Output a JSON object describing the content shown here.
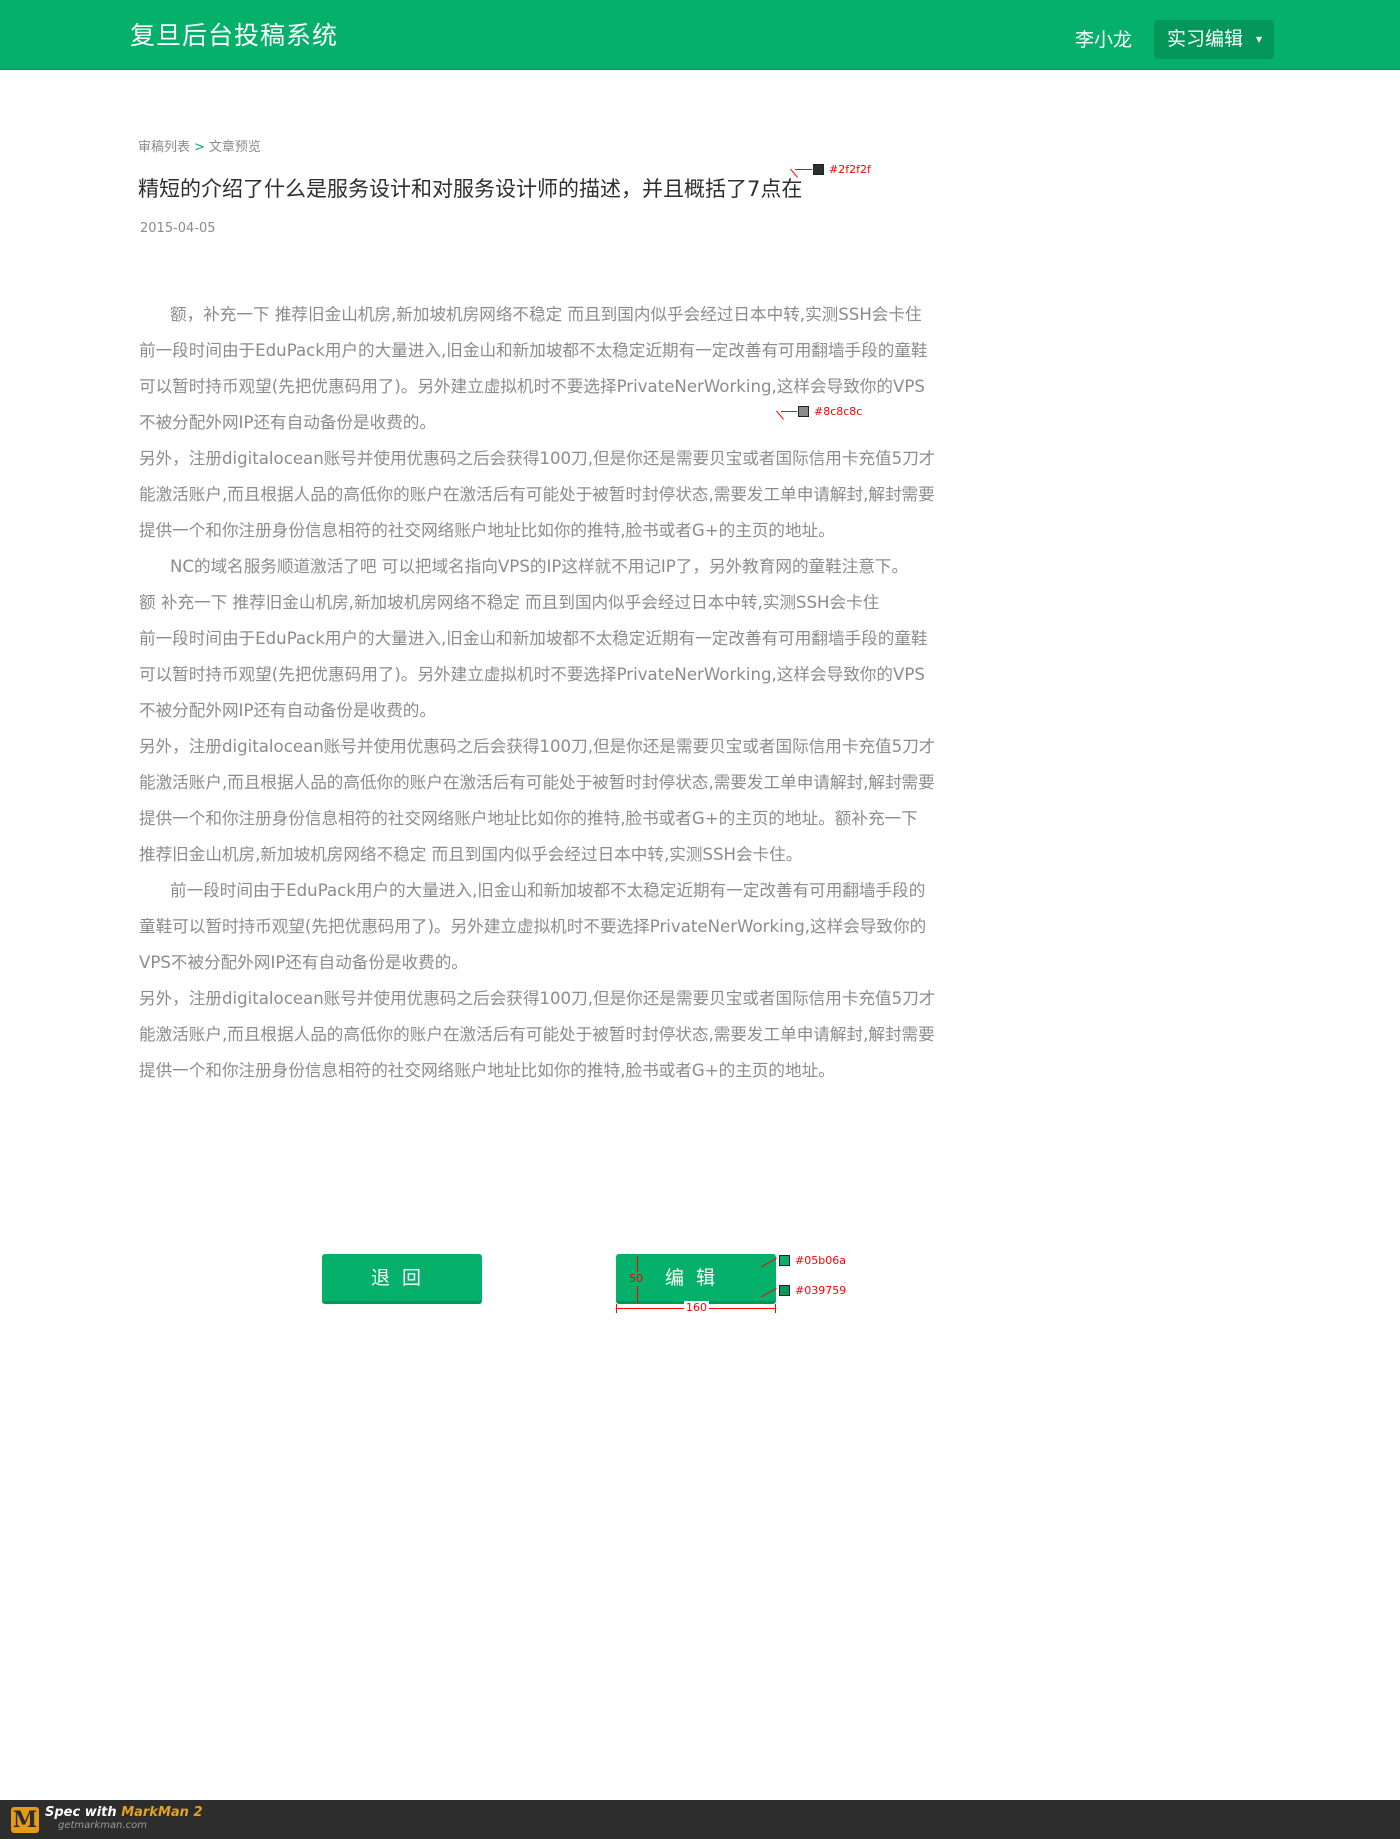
{
  "header": {
    "app_title": "复旦后台投稿系统",
    "user_name": "李小龙",
    "role_menu_label": "实习编辑",
    "role_menu_caret": "▾"
  },
  "breadcrumb": {
    "items": [
      "审稿列表",
      "文章预览"
    ],
    "separator": ">"
  },
  "article": {
    "title": "精短的介绍了什么是服务设计和对服务设计师的描述，并且概括了7点在",
    "date": "2015-04-05",
    "paragraphs": [
      "额，补充一下 推荐旧金山机房,新加坡机房网络不稳定 而且到国内似乎会经过日本中转,实测SSH会卡住",
      "前一段时间由于EduPack用户的大量进入,旧金山和新加坡都不太稳定近期有一定改善有可用翻墙手段的童鞋可以暂时持币观望(先把优惠码用了)。另外建立虚拟机时不要选择PrivateNerWorking,这样会导致你的VPS不被分配外网IP还有自动备份是收费的。",
      "另外，注册digitalocean账号并使用优惠码之后会获得100刀,但是你还是需要贝宝或者国际信用卡充值5刀才能激活账户,而且根据人品的高低你的账户在激活后有可能处于被暂时封停状态,需要发工单申请解封,解封需要提供一个和你注册身份信息相符的社交网络账户地址比如你的推特,脸书或者G+的主页的地址。",
      "NC的域名服务顺道激活了吧 可以把域名指向VPS的IP这样就不用记IP了，另外教育网的童鞋注意下。",
      "额 补充一下 推荐旧金山机房,新加坡机房网络不稳定 而且到国内似乎会经过日本中转,实测SSH会卡住",
      "前一段时间由于EduPack用户的大量进入,旧金山和新加坡都不太稳定近期有一定改善有可用翻墙手段的童鞋可以暂时持币观望(先把优惠码用了)。另外建立虚拟机时不要选择PrivateNerWorking,这样会导致你的VPS不被分配外网IP还有自动备份是收费的。",
      "另外，注册digitalocean账号并使用优惠码之后会获得100刀,但是你还是需要贝宝或者国际信用卡充值5刀才能激活账户,而且根据人品的高低你的账户在激活后有可能处于被暂时封停状态,需要发工单申请解封,解封需要提供一个和你注册身份信息相符的社交网络账户地址比如你的推特,脸书或者G+的主页的地址。额补充一下 推荐旧金山机房,新加坡机房网络不稳定 而且到国内似乎会经过日本中转,实测SSH会卡住。",
      "前一段时间由于EduPack用户的大量进入,旧金山和新加坡都不太稳定近期有一定改善有可用翻墙手段的童鞋可以暂时持币观望(先把优惠码用了)。另外建立虚拟机时不要选择PrivateNerWorking,这样会导致你的VPS不被分配外网IP还有自动备份是收费的。",
      "另外，注册digitalocean账号并使用优惠码之后会获得100刀,但是你还是需要贝宝或者国际信用卡充值5刀才能激活账户,而且根据人品的高低你的账户在激活后有可能处于被暂时封停状态,需要发工单申请解封,解封需要提供一个和你注册身份信息相符的社交网络账户地址比如你的推特,脸书或者G+的主页的地址。"
    ]
  },
  "actions": {
    "back_label": "退回",
    "edit_label": "编辑"
  },
  "annotations": {
    "title_color": "#2f2f2f",
    "body_color": "#8c8c8c",
    "button_color": "#05b06a",
    "button_border_color": "#039759",
    "button_height": "50",
    "button_width": "160"
  },
  "footer": {
    "spec_text": "Spec with ",
    "spec_brand": "MarkMan 2",
    "spec_url": "getmarkman.com",
    "logo_letter": "M"
  }
}
